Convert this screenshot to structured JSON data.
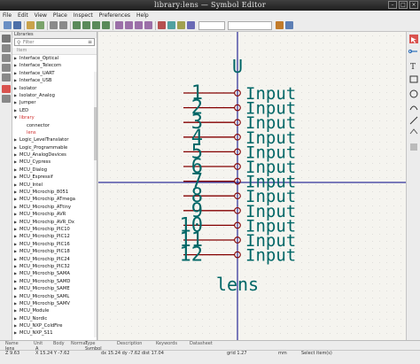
{
  "window": {
    "title": "library:lens — Symbol Editor"
  },
  "menu": [
    "File",
    "Edit",
    "View",
    "Place",
    "Inspect",
    "Preferences",
    "Help"
  ],
  "libraries": {
    "header": "Libraries",
    "search_placeholder": "Filter",
    "column_header": "Item",
    "items": [
      {
        "label": "Interface_Optical",
        "expanded": false
      },
      {
        "label": "Interface_Telecom",
        "expanded": false
      },
      {
        "label": "Interface_UART",
        "expanded": false
      },
      {
        "label": "Interface_USB",
        "expanded": false
      },
      {
        "label": "Isolator",
        "expanded": false
      },
      {
        "label": "Isolator_Analog",
        "expanded": false
      },
      {
        "label": "Jumper",
        "expanded": false
      },
      {
        "label": "LED",
        "expanded": false
      },
      {
        "label": "library",
        "expanded": true,
        "selected": true
      },
      {
        "label": "connector",
        "child": true
      },
      {
        "label": "lens",
        "child": true,
        "current": true
      },
      {
        "label": "Logic_LevelTranslator",
        "expanded": false
      },
      {
        "label": "Logic_Programmable",
        "expanded": false
      },
      {
        "label": "MCU_AnalogDevices",
        "expanded": false
      },
      {
        "label": "MCU_Cypress",
        "expanded": false
      },
      {
        "label": "MCU_Dialog",
        "expanded": false
      },
      {
        "label": "MCU_Espressif",
        "expanded": false
      },
      {
        "label": "MCU_Intel",
        "expanded": false
      },
      {
        "label": "MCU_Microchip_8051",
        "expanded": false
      },
      {
        "label": "MCU_Microchip_ATmega",
        "expanded": false
      },
      {
        "label": "MCU_Microchip_ATtiny",
        "expanded": false
      },
      {
        "label": "MCU_Microchip_AVR",
        "expanded": false
      },
      {
        "label": "MCU_Microchip_AVR_Dx",
        "expanded": false
      },
      {
        "label": "MCU_Microchip_PIC10",
        "expanded": false
      },
      {
        "label": "MCU_Microchip_PIC12",
        "expanded": false
      },
      {
        "label": "MCU_Microchip_PIC16",
        "expanded": false
      },
      {
        "label": "MCU_Microchip_PIC18",
        "expanded": false
      },
      {
        "label": "MCU_Microchip_PIC24",
        "expanded": false
      },
      {
        "label": "MCU_Microchip_PIC32",
        "expanded": false
      },
      {
        "label": "MCU_Microchip_SAMA",
        "expanded": false
      },
      {
        "label": "MCU_Microchip_SAMD",
        "expanded": false
      },
      {
        "label": "MCU_Microchip_SAME",
        "expanded": false
      },
      {
        "label": "MCU_Microchip_SAML",
        "expanded": false
      },
      {
        "label": "MCU_Microchip_SAMV",
        "expanded": false
      },
      {
        "label": "MCU_Module",
        "expanded": false
      },
      {
        "label": "MCU_Nordic",
        "expanded": false
      },
      {
        "label": "MCU_NXP_ColdFire",
        "expanded": false
      },
      {
        "label": "MCU_NXP_S11",
        "expanded": false
      }
    ]
  },
  "symbol": {
    "reference": "U",
    "value": "lens",
    "pins": [
      {
        "number": "1",
        "name": "Input"
      },
      {
        "number": "2",
        "name": "Input"
      },
      {
        "number": "3",
        "name": "Input"
      },
      {
        "number": "4",
        "name": "Input"
      },
      {
        "number": "5",
        "name": "Input"
      },
      {
        "number": "6",
        "name": "Input"
      },
      {
        "number": "7",
        "name": "Input"
      },
      {
        "number": "8",
        "name": "Input"
      },
      {
        "number": "9",
        "name": "Input"
      },
      {
        "number": "10",
        "name": "Input"
      },
      {
        "number": "11",
        "name": "Input"
      },
      {
        "number": "12",
        "name": "Input"
      }
    ],
    "colors": {
      "text": "#006666",
      "pin": "#840000",
      "axis": "#000084",
      "background": "#f5f4ef"
    }
  },
  "message_panel": {
    "headers": [
      "Name",
      "Unit",
      "Body",
      "Normal",
      "Type",
      "Description",
      "Keywords",
      "Datasheet"
    ],
    "values": [
      "lens",
      "A",
      "",
      "",
      "Symbol",
      "",
      "",
      ""
    ]
  },
  "status": {
    "zoom": "Z 9.63",
    "xy": "X 15.24  Y -7.62",
    "dxdy": "dx 15.24  dy -7.62  dist 17.04",
    "grid": "grid 1.27",
    "units": "mm",
    "mode": "Select item(s)"
  }
}
